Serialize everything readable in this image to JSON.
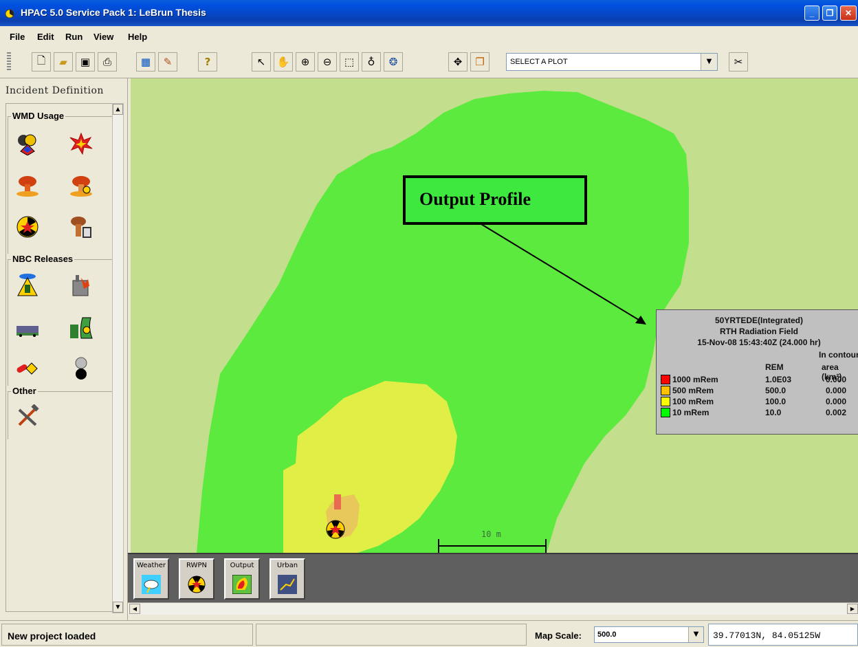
{
  "window": {
    "title": "HPAC 5.0 Service Pack 1: LeBrun Thesis",
    "controls": [
      "minimize",
      "restore",
      "close"
    ]
  },
  "menu": [
    "File",
    "Edit",
    "Run",
    "View",
    "Help"
  ],
  "toolbar": {
    "buttons": [
      {
        "name": "new-file-icon",
        "glyph": "🗋"
      },
      {
        "name": "open-folder-icon",
        "glyph": "📂"
      },
      {
        "name": "save-icon",
        "glyph": "💾"
      },
      {
        "name": "print-icon",
        "glyph": "🖶"
      },
      {
        "name": "calculator-icon",
        "glyph": "🖩"
      },
      {
        "name": "edit-pencil-icon",
        "glyph": "✎"
      },
      {
        "name": "help-icon",
        "glyph": "?"
      },
      {
        "name": "pointer-icon",
        "glyph": "↖"
      },
      {
        "name": "pan-hand-icon",
        "glyph": "✋"
      },
      {
        "name": "zoom-in-icon",
        "glyph": "⊕"
      },
      {
        "name": "zoom-out-icon",
        "glyph": "⊖"
      },
      {
        "name": "select-box-icon",
        "glyph": "⬚"
      },
      {
        "name": "probe-icon",
        "glyph": "♁"
      },
      {
        "name": "globe-icon",
        "glyph": "❂"
      },
      {
        "name": "move-arrows-icon",
        "glyph": "✥"
      },
      {
        "name": "layers-icon",
        "glyph": "❐"
      },
      {
        "name": "scissors-icon",
        "glyph": "✂"
      }
    ],
    "plot_select": "SELECT A PLOT"
  },
  "left_panel": {
    "title": "Incident Definition",
    "groups": [
      {
        "label": "WMD Usage",
        "icons": [
          "hazard-mix-icon",
          "explosion-icon",
          "nuclear-cloud-icon",
          "nuclear-cloud-2-icon",
          "radiation-blast-icon",
          "nuclear-calculator-icon"
        ]
      },
      {
        "label": "NBC Releases",
        "icons": [
          "chemical-release-icon",
          "facility-fire-icon",
          "train-release-icon",
          "reactor-icon",
          "pills-icon",
          "bomb-icon"
        ]
      },
      {
        "label": "Other",
        "icons": [
          "tools-icon"
        ]
      }
    ]
  },
  "map": {
    "colors": {
      "background": "#c3df8e",
      "contour_10": "#5cea3f",
      "contour_100": "#e1ee46",
      "contour_500": "#e8c85a",
      "contour_1000": "#e86a50"
    },
    "annotation": "Output Profile",
    "scale_label": "10 m",
    "legend": {
      "line1": "50YRTEDE(Integrated)",
      "line2": "RTH Radiation Field",
      "line3": "15-Nov-08 15:43:40Z (24.000 hr)",
      "col_area_head1": "In contour",
      "col_rem_head": "REM",
      "col_area_head2": "area (km²)",
      "rows": [
        {
          "label": "1000 mRem",
          "rem": "1.0E03",
          "area": "0.000",
          "color": "#ff0000"
        },
        {
          "label": "500 mRem",
          "rem": "500.0",
          "area": "0.000",
          "color": "#ffc000"
        },
        {
          "label": "100 mRem",
          "rem": "100.0",
          "area": "0.000",
          "color": "#ffff00"
        },
        {
          "label": "10 mRem",
          "rem": "10.0",
          "area": "0.002",
          "color": "#00ff00"
        }
      ]
    }
  },
  "dock": {
    "tabs": [
      "Weather",
      "RWPN",
      "Output",
      "Urban"
    ]
  },
  "status": {
    "message": "New project loaded",
    "map_scale_label": "Map Scale:",
    "map_scale_value": "500.0",
    "coordinates": "39.77013N, 84.05125W"
  }
}
